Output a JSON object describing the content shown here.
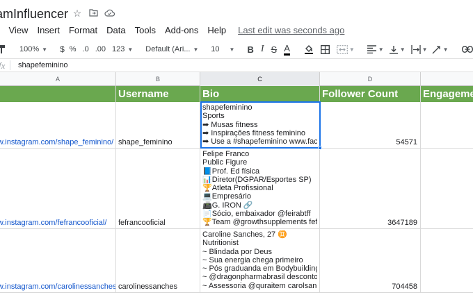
{
  "app": {
    "title": "ramInfluencer",
    "title_icons": [
      "star-icon",
      "move-to-folder-icon",
      "cloud-saved-icon"
    ]
  },
  "menu": {
    "items": [
      "it",
      "View",
      "Insert",
      "Format",
      "Data",
      "Tools",
      "Add-ons",
      "Help"
    ],
    "last_edit": "Last edit was seconds ago"
  },
  "toolbar": {
    "paint_format": "paint-format-icon",
    "zoom": "100%",
    "currency": "$",
    "percent": "%",
    "decrease_decimals": ".0",
    "increase_decimals": ".00",
    "more_formats": "123",
    "font": "Default (Ari...",
    "font_size": "10",
    "bold": "B",
    "italic": "I",
    "strikethrough": "S",
    "text_color": "A"
  },
  "formula_bar": {
    "fx": "fx",
    "value": "shapefeminino"
  },
  "columns": [
    "A",
    "B",
    "C",
    "D"
  ],
  "header_row": [
    "",
    "Username",
    "Bio",
    "Follower Count",
    "Engagemen"
  ],
  "rows": [
    {
      "url": "https://www.instagram.com/shape_feminino/",
      "username": "shape_feminino",
      "bio": [
        "shapefeminino",
        "Sports",
        "➡ Musas fitness",
        "➡ Inspirações fitness feminino",
        "➡ Use a #shapefeminino www.facebook.com/shapefeminino"
      ],
      "followers": "54571"
    },
    {
      "url": "https://www.instagram.com/fefrancooficial/",
      "username": "fefrancooficial",
      "bio": [
        "Felipe Franco",
        "Public Figure",
        "📘Prof. Ed física",
        "📊Diretor(DGPAR/Esportes SP)",
        "🏆Atleta Profissional",
        "💻Empresário",
        "📠G. IRON 🔗",
        "📄Sócio, embaixador @feirabtff",
        "🏆Team @growthsupplements fefrancooficial"
      ],
      "followers": "3647189"
    },
    {
      "url": "https://www.instagram.com/carolinessanches/",
      "username": "carolinessanches",
      "bio": [
        "Caroline Sanches, 27 ♊",
        "Nutritionist",
        "~ Blindada por Deus",
        "~ Sua energia chega primeiro",
        "~ Pós graduanda em BodybuildingCoach",
        "~ @dragonpharmabrasil desconto: CAROL",
        "~ Assessoria @quraitem carolsanches"
      ],
      "followers": "704458"
    }
  ],
  "colors": {
    "header_green": "#6aa84f",
    "selection_blue": "#1a73e8",
    "link_blue": "#1155cc"
  }
}
